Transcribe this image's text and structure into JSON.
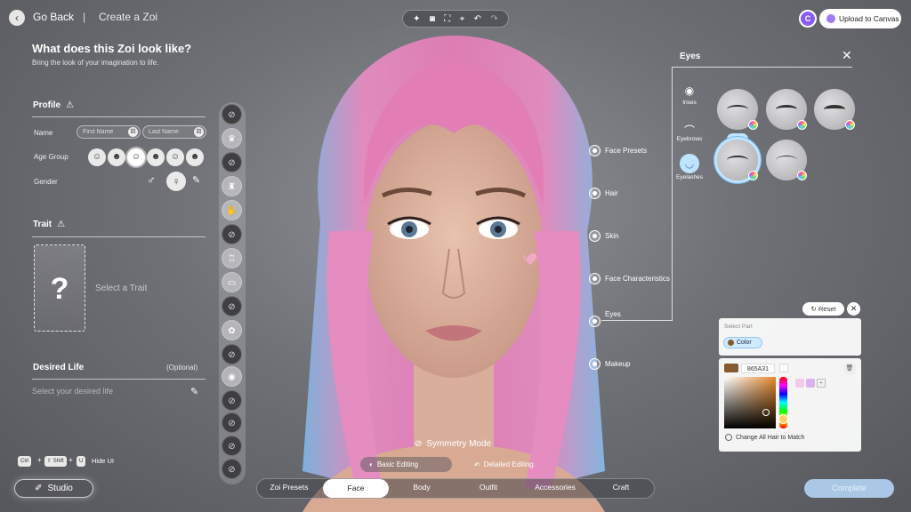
{
  "header": {
    "back_label": "Go Back",
    "separator": "|",
    "page_title": "Create a Zoi",
    "toolbar_icons": [
      "sparkle-icon",
      "camera-icon",
      "frame-icon",
      "focus-icon",
      "undo-icon",
      "redo-icon"
    ],
    "upload_label": "Upload to Canvas",
    "avatar_initial": "C"
  },
  "left_panel": {
    "title": "What does this Zoi look like?",
    "subtitle": "Bring the look of your imagination to life.",
    "profile": {
      "title": "Profile",
      "name_label": "Name",
      "first_name_placeholder": "First Name",
      "last_name_placeholder": "Last Name",
      "age_group_label": "Age Group",
      "age_groups": [
        "baby-icon",
        "student-icon",
        "young-adult-icon",
        "adult-icon",
        "middle-aged-icon",
        "elder-icon"
      ],
      "selected_age_index": 2,
      "gender_label": "Gender",
      "gender_options": [
        "male-icon",
        "female-icon"
      ],
      "selected_gender": "female-icon"
    },
    "trait": {
      "title": "Trait",
      "card_symbol": "?",
      "select_label": "Select a Trait"
    },
    "desired_life": {
      "title": "Desired Life",
      "optional_label": "(Optional)",
      "placeholder": "Select your desired life"
    },
    "shortcut": {
      "keys": [
        "Ctrl",
        "⇧ Shift",
        "U"
      ],
      "label": "Hide UI"
    },
    "studio_label": "Studio"
  },
  "hotspots": [
    {
      "label": "Face Presets"
    },
    {
      "label": "Hair"
    },
    {
      "label": "Skin"
    },
    {
      "label": "Face Characteristics"
    },
    {
      "label": "Eyes"
    },
    {
      "label": "Makeup"
    }
  ],
  "eyes_panel": {
    "title": "Eyes",
    "categories": [
      {
        "label": "Irises",
        "icon": "iris-icon"
      },
      {
        "label": "Eyebrows",
        "icon": "eyebrow-icon"
      },
      {
        "label": "Eyelashes",
        "icon": "eyelash-icon"
      }
    ],
    "selected_category": "Eyelashes",
    "selected_style_index": 3
  },
  "color_panel": {
    "reset_label": "Reset",
    "select_part_label": "Select Part",
    "part_chip_label": "Color",
    "hex_value": "865A31",
    "change_all_label": "Change All Hair to Match",
    "color": "#865a31",
    "preset_swatches": [
      "#f3c9ec",
      "#d8b3ee"
    ]
  },
  "bottom": {
    "symmetry_label": "Symmetry Mode",
    "basic_editing_label": "Basic Editing",
    "detailed_editing_label": "Detailed Editing",
    "tabs": [
      "Zoi Presets",
      "Face",
      "Body",
      "Outfit",
      "Accessories",
      "Craft"
    ],
    "selected_tab": "Face",
    "complete_label": "Complete"
  },
  "colors": {
    "accent_blue": "#bfe4ff",
    "complete_disabled": "#aac8e6",
    "avatar_purple": "#8a5cf0"
  }
}
